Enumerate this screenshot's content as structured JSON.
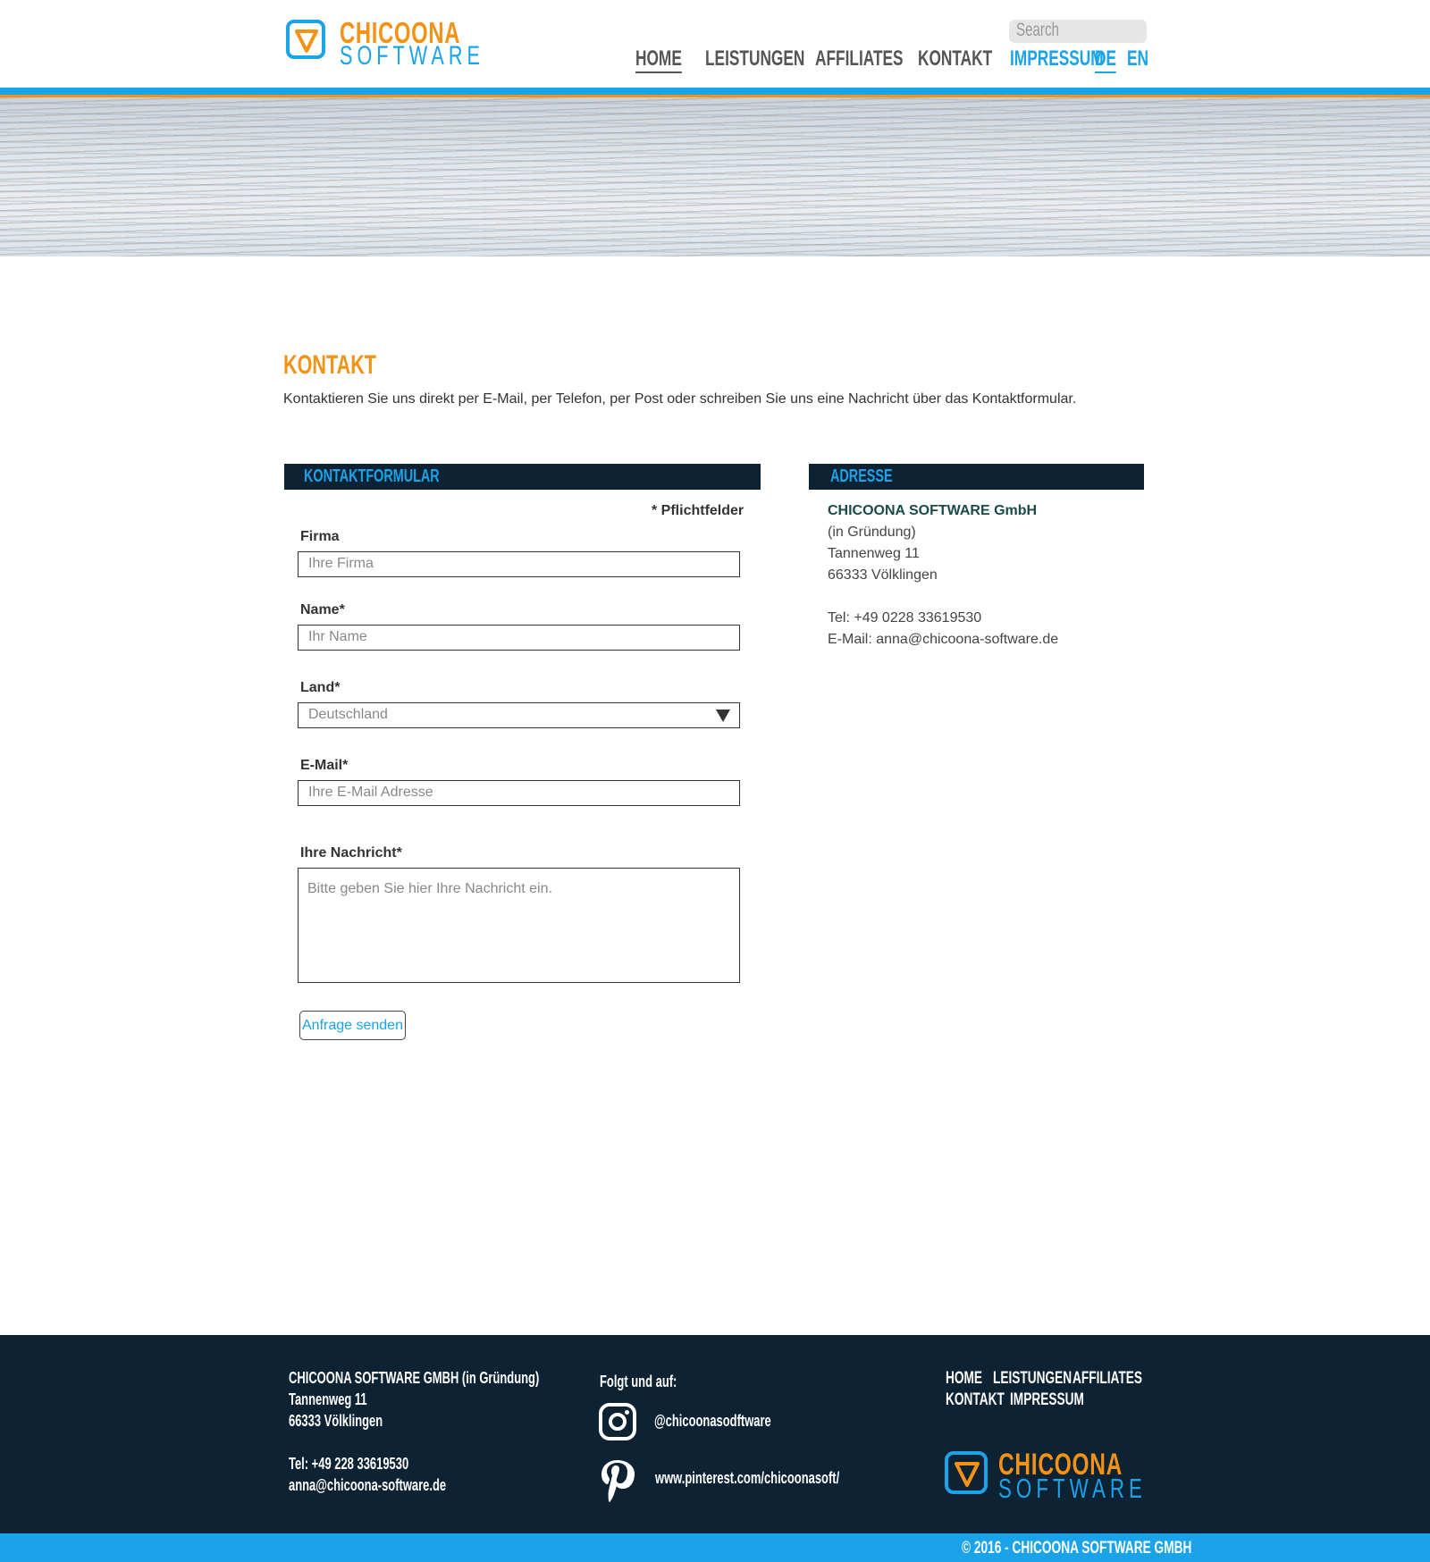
{
  "header": {
    "logo_top": "CHICOONA",
    "logo_bottom": "SOFTWARE",
    "search_placeholder": "Search",
    "nav": [
      "HOME",
      "LEISTUNGEN",
      "AFFILIATES",
      "KONTAKT"
    ],
    "util": [
      "IMPRESSUM",
      "DE",
      "EN"
    ]
  },
  "main": {
    "title": "KONTAKT",
    "intro": "Kontaktieren Sie uns direkt per E-Mail, per Telefon, per Post oder schreiben Sie uns eine Nachricht über das Kontaktformular."
  },
  "form": {
    "heading": "KONTAKTFORMULAR",
    "required_note": "* Pflichtfelder",
    "firma_label": "Firma",
    "firma_placeholder": "Ihre Firma",
    "name_label": "Name*",
    "name_placeholder": "Ihr Name",
    "land_label": "Land*",
    "land_value": "Deutschland",
    "email_label": "E-Mail*",
    "email_placeholder": "Ihre E-Mail Adresse",
    "message_label": "Ihre Nachricht*",
    "message_placeholder": "Bitte geben Sie hier Ihre Nachricht ein.",
    "submit": "Anfrage senden"
  },
  "address": {
    "heading": "ADRESSE",
    "company": "CHICOONA SOFTWARE GmbH",
    "note": "(in Gründung)",
    "street": "Tannenweg 11",
    "city": "66333 Völklingen",
    "tel": "Tel: +49 0228 33619530",
    "email": "E-Mail: anna@chicoona-software.de"
  },
  "footer": {
    "company": "CHICOONA SOFTWARE GMBH (in Gründung)",
    "street": "Tannenweg 11",
    "city": "66333 Völklingen",
    "tel": "Tel: +49 228 33619530",
    "email": "anna@chicoona-software.de",
    "follow": "Folgt und auf:",
    "instagram": "@chicoonasodftware",
    "pinterest": "www.pinterest.com/chicoonasoft/",
    "nav": [
      "HOME",
      "LEISTUNGEN",
      "AFFILIATES",
      "KONTAKT",
      "IMPRESSUM"
    ],
    "copyright": "© 2016 - CHICOONA SOFTWARE GMBH"
  },
  "colors": {
    "brand_blue": "#1aa3e8",
    "brand_orange": "#f39214",
    "navy": "#0d2233"
  }
}
